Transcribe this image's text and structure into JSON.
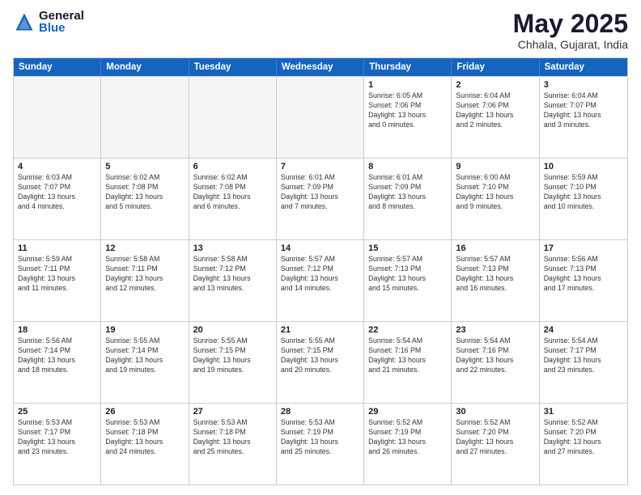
{
  "logo": {
    "general": "General",
    "blue": "Blue"
  },
  "title": "May 2025",
  "location": "Chhala, Gujarat, India",
  "days": [
    "Sunday",
    "Monday",
    "Tuesday",
    "Wednesday",
    "Thursday",
    "Friday",
    "Saturday"
  ],
  "weeks": [
    [
      {
        "day": "",
        "info": ""
      },
      {
        "day": "",
        "info": ""
      },
      {
        "day": "",
        "info": ""
      },
      {
        "day": "",
        "info": ""
      },
      {
        "day": "1",
        "info": "Sunrise: 6:05 AM\nSunset: 7:06 PM\nDaylight: 13 hours\nand 0 minutes."
      },
      {
        "day": "2",
        "info": "Sunrise: 6:04 AM\nSunset: 7:06 PM\nDaylight: 13 hours\nand 2 minutes."
      },
      {
        "day": "3",
        "info": "Sunrise: 6:04 AM\nSunset: 7:07 PM\nDaylight: 13 hours\nand 3 minutes."
      }
    ],
    [
      {
        "day": "4",
        "info": "Sunrise: 6:03 AM\nSunset: 7:07 PM\nDaylight: 13 hours\nand 4 minutes."
      },
      {
        "day": "5",
        "info": "Sunrise: 6:02 AM\nSunset: 7:08 PM\nDaylight: 13 hours\nand 5 minutes."
      },
      {
        "day": "6",
        "info": "Sunrise: 6:02 AM\nSunset: 7:08 PM\nDaylight: 13 hours\nand 6 minutes."
      },
      {
        "day": "7",
        "info": "Sunrise: 6:01 AM\nSunset: 7:09 PM\nDaylight: 13 hours\nand 7 minutes."
      },
      {
        "day": "8",
        "info": "Sunrise: 6:01 AM\nSunset: 7:09 PM\nDaylight: 13 hours\nand 8 minutes."
      },
      {
        "day": "9",
        "info": "Sunrise: 6:00 AM\nSunset: 7:10 PM\nDaylight: 13 hours\nand 9 minutes."
      },
      {
        "day": "10",
        "info": "Sunrise: 5:59 AM\nSunset: 7:10 PM\nDaylight: 13 hours\nand 10 minutes."
      }
    ],
    [
      {
        "day": "11",
        "info": "Sunrise: 5:59 AM\nSunset: 7:11 PM\nDaylight: 13 hours\nand 11 minutes."
      },
      {
        "day": "12",
        "info": "Sunrise: 5:58 AM\nSunset: 7:11 PM\nDaylight: 13 hours\nand 12 minutes."
      },
      {
        "day": "13",
        "info": "Sunrise: 5:58 AM\nSunset: 7:12 PM\nDaylight: 13 hours\nand 13 minutes."
      },
      {
        "day": "14",
        "info": "Sunrise: 5:57 AM\nSunset: 7:12 PM\nDaylight: 13 hours\nand 14 minutes."
      },
      {
        "day": "15",
        "info": "Sunrise: 5:57 AM\nSunset: 7:13 PM\nDaylight: 13 hours\nand 15 minutes."
      },
      {
        "day": "16",
        "info": "Sunrise: 5:57 AM\nSunset: 7:13 PM\nDaylight: 13 hours\nand 16 minutes."
      },
      {
        "day": "17",
        "info": "Sunrise: 5:56 AM\nSunset: 7:13 PM\nDaylight: 13 hours\nand 17 minutes."
      }
    ],
    [
      {
        "day": "18",
        "info": "Sunrise: 5:56 AM\nSunset: 7:14 PM\nDaylight: 13 hours\nand 18 minutes."
      },
      {
        "day": "19",
        "info": "Sunrise: 5:55 AM\nSunset: 7:14 PM\nDaylight: 13 hours\nand 19 minutes."
      },
      {
        "day": "20",
        "info": "Sunrise: 5:55 AM\nSunset: 7:15 PM\nDaylight: 13 hours\nand 19 minutes."
      },
      {
        "day": "21",
        "info": "Sunrise: 5:55 AM\nSunset: 7:15 PM\nDaylight: 13 hours\nand 20 minutes."
      },
      {
        "day": "22",
        "info": "Sunrise: 5:54 AM\nSunset: 7:16 PM\nDaylight: 13 hours\nand 21 minutes."
      },
      {
        "day": "23",
        "info": "Sunrise: 5:54 AM\nSunset: 7:16 PM\nDaylight: 13 hours\nand 22 minutes."
      },
      {
        "day": "24",
        "info": "Sunrise: 5:54 AM\nSunset: 7:17 PM\nDaylight: 13 hours\nand 23 minutes."
      }
    ],
    [
      {
        "day": "25",
        "info": "Sunrise: 5:53 AM\nSunset: 7:17 PM\nDaylight: 13 hours\nand 23 minutes."
      },
      {
        "day": "26",
        "info": "Sunrise: 5:53 AM\nSunset: 7:18 PM\nDaylight: 13 hours\nand 24 minutes."
      },
      {
        "day": "27",
        "info": "Sunrise: 5:53 AM\nSunset: 7:18 PM\nDaylight: 13 hours\nand 25 minutes."
      },
      {
        "day": "28",
        "info": "Sunrise: 5:53 AM\nSunset: 7:19 PM\nDaylight: 13 hours\nand 25 minutes."
      },
      {
        "day": "29",
        "info": "Sunrise: 5:52 AM\nSunset: 7:19 PM\nDaylight: 13 hours\nand 26 minutes."
      },
      {
        "day": "30",
        "info": "Sunrise: 5:52 AM\nSunset: 7:20 PM\nDaylight: 13 hours\nand 27 minutes."
      },
      {
        "day": "31",
        "info": "Sunrise: 5:52 AM\nSunset: 7:20 PM\nDaylight: 13 hours\nand 27 minutes."
      }
    ]
  ]
}
